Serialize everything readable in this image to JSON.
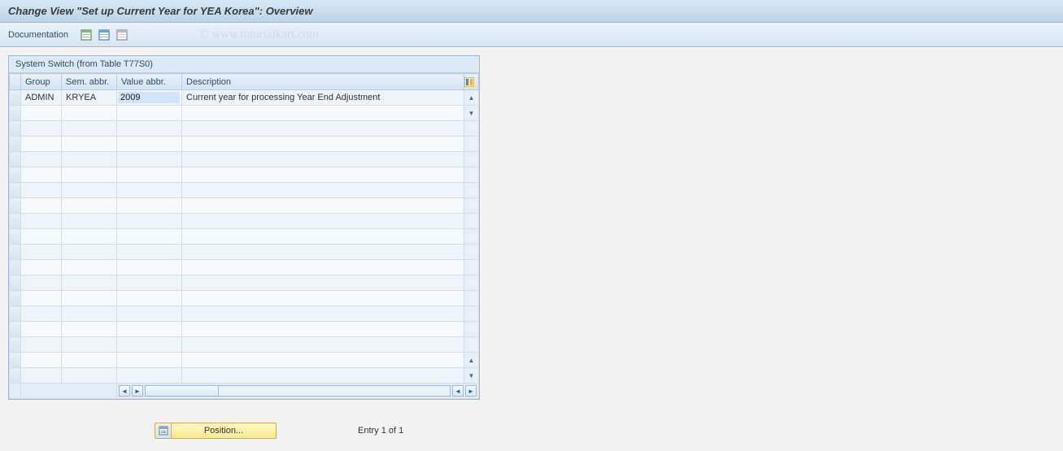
{
  "title": "Change View \"Set up Current Year for YEA Korea\": Overview",
  "toolbar": {
    "documentation_label": "Documentation"
  },
  "watermark": "© www.tutorialkart.com",
  "panel": {
    "header": "System Switch (from Table T77S0)",
    "columns": {
      "group": "Group",
      "sem": "Sem. abbr.",
      "value": "Value abbr.",
      "desc": "Description"
    },
    "rows": [
      {
        "group": "ADMIN",
        "sem": "KRYEA",
        "value": "2009",
        "desc": "Current year for processing Year End Adjustment"
      }
    ]
  },
  "footer": {
    "position_label": "Position...",
    "entry_text": "Entry 1 of 1"
  }
}
